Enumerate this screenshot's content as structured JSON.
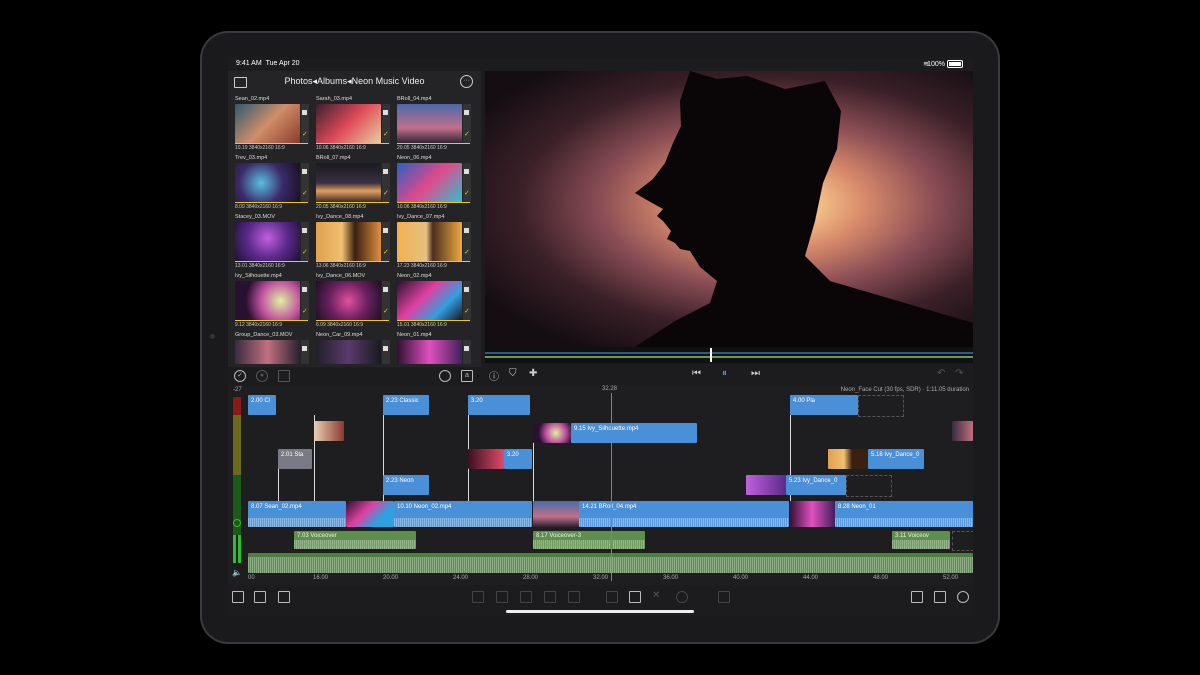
{
  "status": {
    "time": "9:41 AM",
    "date": "Tue Apr 20",
    "battery": "100%"
  },
  "browser": {
    "breadcrumb": "Photos◂Albums◂Neon Music Video",
    "clips": [
      {
        "name": "Sean_02.mp4",
        "duration": "10.19",
        "res": "3840x2160",
        "aspect": "16:9"
      },
      {
        "name": "Sarah_03.mp4",
        "duration": "10.06",
        "res": "3840x2160",
        "aspect": "16:9"
      },
      {
        "name": "BRoll_04.mp4",
        "duration": "20.05",
        "res": "3840x2160",
        "aspect": "16:9"
      },
      {
        "name": "Trev_03.mp4",
        "duration": "8.09",
        "res": "3840x2160",
        "aspect": "16:9"
      },
      {
        "name": "BRoll_07.mp4",
        "duration": "20.05",
        "res": "3840x2160",
        "aspect": "16:9"
      },
      {
        "name": "Neon_06.mp4",
        "duration": "10.06",
        "res": "3840x2160",
        "aspect": "16:9"
      },
      {
        "name": "Stacey_03.MOV",
        "duration": "13.01",
        "res": "3840x2160",
        "aspect": "16:9"
      },
      {
        "name": "Ivy_Dance_08.mp4",
        "duration": "13.06",
        "res": "3840x2160",
        "aspect": "16:9"
      },
      {
        "name": "Ivy_Dance_07.mp4",
        "duration": "17.23",
        "res": "3840x2160",
        "aspect": "16:9"
      },
      {
        "name": "Ivy_Silhouette.mp4",
        "duration": "9.12",
        "res": "3840x2160",
        "aspect": "16:9"
      },
      {
        "name": "Ivy_Dance_06.MOV",
        "duration": "6.09",
        "res": "3840x2160",
        "aspect": "16:9"
      },
      {
        "name": "Neon_02.mp4",
        "duration": "15.01",
        "res": "3840x2160",
        "aspect": "16:9"
      },
      {
        "name": "Group_Dance_03.MOV",
        "duration": "",
        "res": "",
        "aspect": ""
      },
      {
        "name": "Neon_Car_09.mp4",
        "duration": "",
        "res": "",
        "aspect": ""
      },
      {
        "name": "Neon_01.mp4",
        "duration": "",
        "res": "",
        "aspect": ""
      }
    ]
  },
  "timeline": {
    "level_left": "-27",
    "playhead_time": "32.28",
    "project_info": "Neon_Face Cut (30 fps, SDR) · 1:11.05 duration",
    "clips": {
      "c1": "2.00  Cl",
      "c2": "2.23  Classic",
      "c3": "3.20",
      "c4": "4.00  Pla",
      "c5": "2.01  Sta",
      "c6": "9.15  Ivy_Silhouette.mp4",
      "c7": "3.20",
      "c8": "5.18  Ivy_Dance_0",
      "c9": "2.23  Neon",
      "c10": "5.23  Ivy_Dance_0",
      "m1": "8.07  Sean_02.mp4",
      "m2": "10.10  Neon_02.mp4",
      "m3": "14.21  BRoll_04.mp4",
      "m4": "8.28  Neon_01",
      "a1": "7.03  Voiceover",
      "a2": "8.17  Voiceover-3",
      "a3": "3.11  Voiceov"
    },
    "ruler": [
      "00",
      "16.00",
      "20.00",
      "24.00",
      "28.00",
      "32.00",
      "36.00",
      "40.00",
      "44.00",
      "48.00",
      "52.00"
    ]
  }
}
